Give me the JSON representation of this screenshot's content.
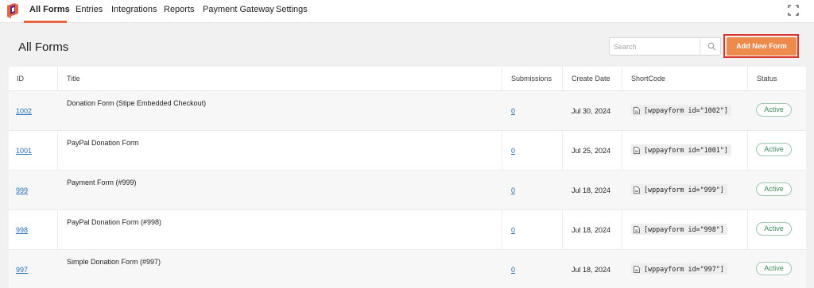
{
  "nav": {
    "items": [
      {
        "label": "All Forms",
        "active": true
      },
      {
        "label": "Entries"
      },
      {
        "label": "Integrations"
      },
      {
        "label": "Reports"
      },
      {
        "label": "Payment Gateway"
      },
      {
        "label": "Settings"
      }
    ],
    "accent_color": "#e9643f"
  },
  "page": {
    "title": "All Forms",
    "search_placeholder": "Search",
    "add_button_label": "Add New Form"
  },
  "table": {
    "headers": [
      "ID",
      "Title",
      "Submissions",
      "Create Date",
      "ShortCode",
      "Status"
    ],
    "rows": [
      {
        "id": "1002",
        "title": "Donation Form (Stipe Embedded Checkout)",
        "submissions": "0",
        "date": "Jul 30, 2024",
        "shortcode": "[wppayform id=\"1002\"]",
        "status": "Active"
      },
      {
        "id": "1001",
        "title": "PayPal Donation Form",
        "submissions": "0",
        "date": "Jul 25, 2024",
        "shortcode": "[wppayform id=\"1001\"]",
        "status": "Active"
      },
      {
        "id": "999",
        "title": "Payment Form (#999)",
        "submissions": "0",
        "date": "Jul 18, 2024",
        "shortcode": "[wppayform id=\"999\"]",
        "status": "Active"
      },
      {
        "id": "998",
        "title": "PayPal Donation Form (#998)",
        "submissions": "0",
        "date": "Jul 18, 2024",
        "shortcode": "[wppayform id=\"998\"]",
        "status": "Active"
      },
      {
        "id": "997",
        "title": "Simple Donation Form (#997)",
        "submissions": "0",
        "date": "Jul 18, 2024",
        "shortcode": "[wppayform id=\"997\"]",
        "status": "Active"
      }
    ]
  },
  "colors": {
    "button": "#ed8b4c",
    "button_highlight": "#d9352b",
    "link": "#2270b5",
    "status_green": "#3f8a5a"
  },
  "icons": {
    "logo": "app-logo",
    "fullscreen": "fullscreen-icon",
    "search": "search-icon",
    "shortcode": "document-icon"
  }
}
